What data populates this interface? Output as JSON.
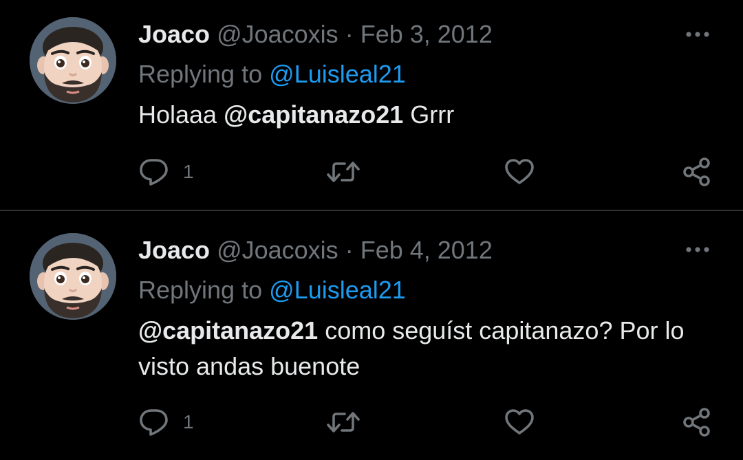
{
  "colors": {
    "background": "#000000",
    "primary_text": "#e7e9ea",
    "secondary_text": "#71767b",
    "link": "#1d9bf0",
    "divider": "#2f3336"
  },
  "tweets": [
    {
      "author": {
        "name": "Joaco",
        "handle": "@Joacoxis"
      },
      "separator": "·",
      "date": "Feb 3, 2012",
      "more_icon": "more-horizontal-icon",
      "replying": {
        "prefix": "Replying to",
        "target": "@Luisleal21"
      },
      "text": {
        "before_mention": "Holaaa ",
        "mention": "@capitanazo21",
        "after_mention": " Grrr"
      },
      "actions": {
        "reply_icon": "reply-bubble-icon",
        "reply_count": "1",
        "retweet_icon": "retweet-icon",
        "like_icon": "heart-icon",
        "share_icon": "share-icon"
      }
    },
    {
      "author": {
        "name": "Joaco",
        "handle": "@Joacoxis"
      },
      "separator": "·",
      "date": "Feb 4, 2012",
      "more_icon": "more-horizontal-icon",
      "replying": {
        "prefix": "Replying to",
        "target": "@Luisleal21"
      },
      "text": {
        "before_mention": "",
        "mention": "@capitanazo21",
        "after_mention": " como seguíst capitanazo? Por lo visto andas buenote"
      },
      "actions": {
        "reply_icon": "reply-bubble-icon",
        "reply_count": "1",
        "retweet_icon": "retweet-icon",
        "like_icon": "heart-icon",
        "share_icon": "share-icon"
      }
    }
  ]
}
